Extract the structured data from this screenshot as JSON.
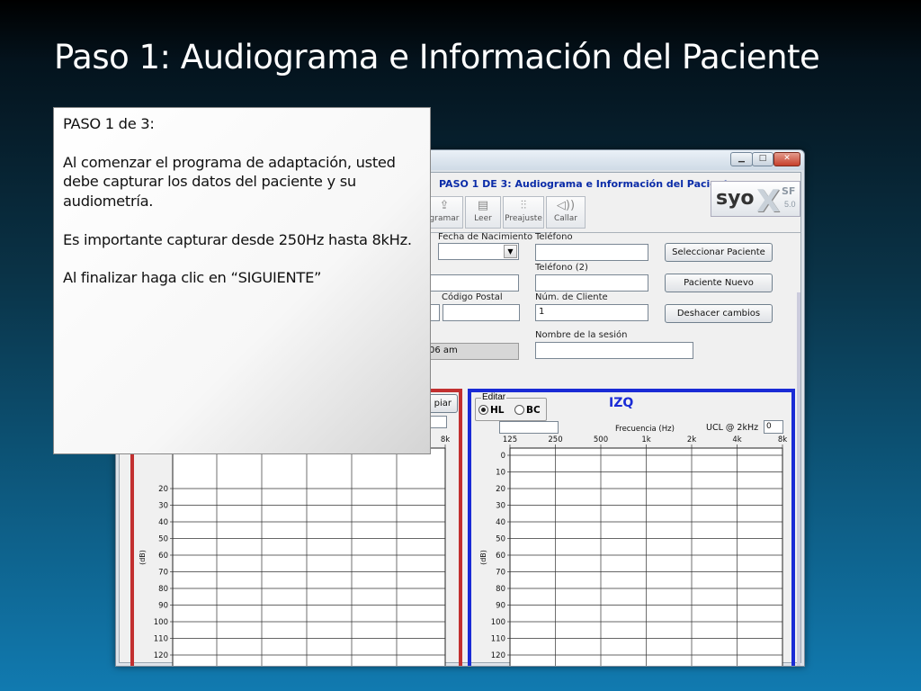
{
  "slide": {
    "title": "Paso 1: Audiograma e Información del Paciente"
  },
  "callout": {
    "step": "PASO 1 de 3:",
    "para1": "Al comenzar el programa de adaptación, usted debe capturar los datos del paciente y su audiometría.",
    "para2": "Es importante capturar desde 250Hz hasta 8kHz.",
    "para3": "Al finalizar haga clic en “SIGUIENTE”"
  },
  "window": {
    "controls": {
      "minimize": "▁",
      "maximize": "□",
      "close": "✕"
    },
    "header_title": "PASO 1 DE 3: Audiograma e Información del Paciente",
    "logo": {
      "brand": "syo",
      "mark": "X",
      "edition": "SF",
      "version": "5.0"
    },
    "toolbar": [
      {
        "label": "gramar",
        "icon": "document-up-icon"
      },
      {
        "label": "Leer",
        "icon": "document-read-icon"
      },
      {
        "label": "Preajuste",
        "icon": "sliders-icon"
      },
      {
        "label": "Callar",
        "icon": "speaker-icon"
      }
    ]
  },
  "form": {
    "fecha_nacimiento_label": "Fecha de Nacimiento",
    "fecha_nacimiento_value": "",
    "telefono_label": "Teléfono",
    "telefono_value": "",
    "telefono2_label": "Teléfono (2)",
    "telefono2_value": "",
    "codigo_postal_label": "Código Postal",
    "codigo_postal_value": "",
    "num_cliente_label": "Núm. de Cliente",
    "num_cliente_value": "1",
    "nombre_sesion_label": "Nombre de la sesión",
    "nombre_sesion_value": "",
    "session_time_value": "06 am",
    "buttons": {
      "seleccionar": "Seleccionar Paciente",
      "nuevo": "Paciente Nuevo",
      "deshacer": "Deshacer cambios"
    }
  },
  "audiogram_left": {
    "clear_button_partial": "piar",
    "freq_partial": "8k"
  },
  "audiogram_right": {
    "title": "IZQ",
    "edit_label": "Editar",
    "hl_label": "HL",
    "bc_label": "BC",
    "selected": "HL",
    "freq_axis_label": "Frecuencia (Hz)",
    "ucl_label": "UCL @ 2kHz",
    "ucl_value": "0",
    "input_value": ""
  },
  "chart_data": [
    {
      "type": "line",
      "name": "audiogram-izq",
      "xlabel": "Frecuencia (Hz)",
      "ylabel": "(dB)",
      "x_ticks": [
        "125",
        "250",
        "500",
        "1k",
        "2k",
        "4k",
        "8k"
      ],
      "y_ticks": [
        0,
        10,
        20,
        30,
        40,
        50,
        60,
        70,
        80,
        90,
        100,
        110,
        120
      ],
      "ylim": [
        120,
        0
      ],
      "series": []
    },
    {
      "type": "line",
      "name": "audiogram-der",
      "ylabel": "(dB)",
      "x_ticks": [
        "8k"
      ],
      "y_ticks": [
        20,
        30,
        40,
        50,
        60,
        70,
        80,
        90,
        100,
        110,
        120
      ],
      "ylim": [
        120,
        0
      ],
      "series": []
    }
  ],
  "colors": {
    "left_border": "#c23030",
    "right_border": "#1a2bd6",
    "title_blue": "#0b2ca8"
  }
}
